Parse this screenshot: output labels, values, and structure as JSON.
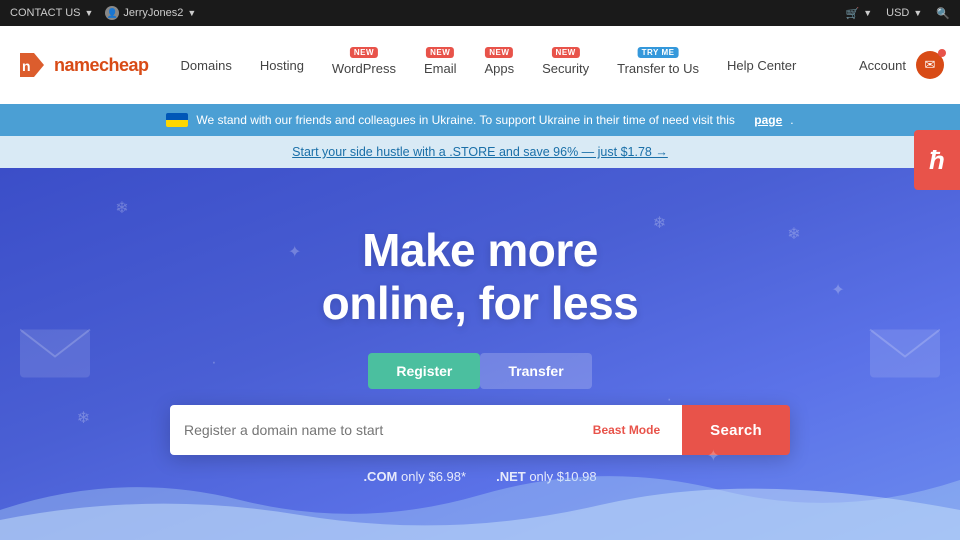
{
  "topbar": {
    "contact_us": "CONTACT US",
    "username": "JerryJones2",
    "cart_icon": "🛒",
    "currency": "USD",
    "search_icon": "🔍"
  },
  "navbar": {
    "logo_text": "namecheap",
    "items": [
      {
        "id": "domains",
        "label": "Domains",
        "badge": null
      },
      {
        "id": "hosting",
        "label": "Hosting",
        "badge": null
      },
      {
        "id": "wordpress",
        "label": "WordPress",
        "badge": "NEW"
      },
      {
        "id": "email",
        "label": "Email",
        "badge": "NEW"
      },
      {
        "id": "apps",
        "label": "Apps",
        "badge": "NEW"
      },
      {
        "id": "security",
        "label": "Security",
        "badge": "NEW"
      },
      {
        "id": "transfer",
        "label": "Transfer to Us",
        "badge": "TRY ME"
      },
      {
        "id": "helpcenter",
        "label": "Help Center",
        "badge": null
      },
      {
        "id": "account",
        "label": "Account",
        "badge": null
      }
    ]
  },
  "ukraine_banner": {
    "text": "We stand with our friends and colleagues in Ukraine. To support Ukraine in their time of need visit this",
    "link_text": "page",
    "link_suffix": "."
  },
  "promo_banner": {
    "text": "Start your side hustle with a .STORE and save 96% — just $1.78 →"
  },
  "hero": {
    "title_line1": "Make more",
    "title_line2": "online, for less",
    "tab_register": "Register",
    "tab_transfer": "Transfer",
    "search_placeholder": "Register a domain name to start",
    "beast_mode_label": "Beast Mode",
    "search_button": "Search",
    "price_com": ".COM only $6.98*",
    "price_net": ".NET only $10.98",
    "price_com_tld": ".COM",
    "price_com_rest": " only $6.98*",
    "price_net_tld": ".NET",
    "price_net_rest": " only $10.98"
  },
  "heureka": {
    "label": "ħ"
  },
  "colors": {
    "accent_red": "#e8534a",
    "accent_green": "#4bbf9f",
    "accent_blue": "#3b4ec8",
    "nav_bg": "#ffffff",
    "topbar_bg": "#1a1a1a"
  }
}
